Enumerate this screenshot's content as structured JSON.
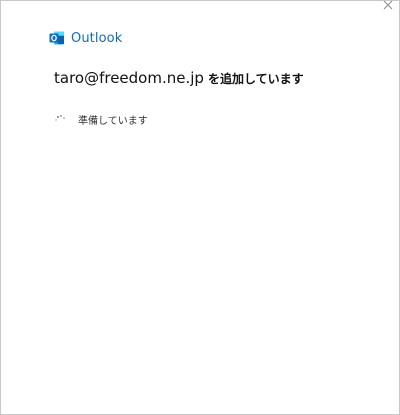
{
  "window": {
    "close_icon": "close-icon"
  },
  "brand": {
    "icon": "outlook-logo-icon",
    "name": "Outlook",
    "color": "#0f6cbd"
  },
  "heading": {
    "email": "taro@freedom.ne.jp",
    "suffix": "を追加しています"
  },
  "status": {
    "spinner_icon": "loading-spinner-icon",
    "text": "準備しています"
  }
}
